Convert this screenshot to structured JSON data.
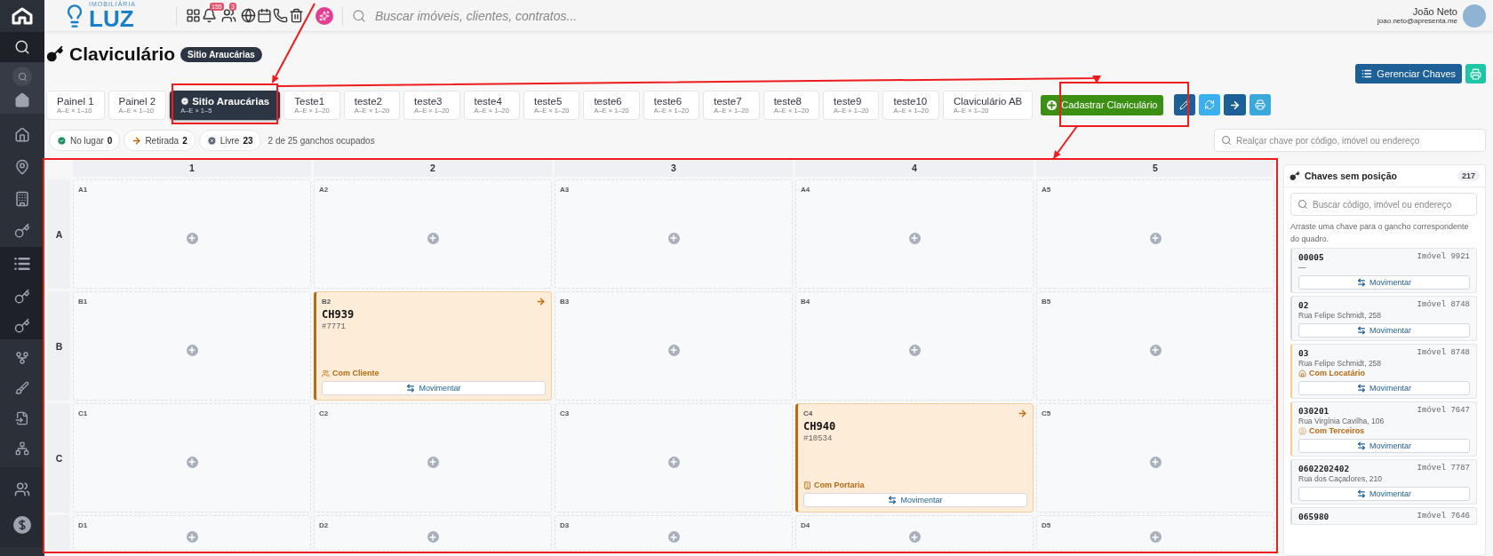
{
  "topbar": {
    "logo_caption": "IMOBILIÁRIA",
    "logo": "LUZ",
    "notification_count": "155",
    "user_count": "3",
    "search_placeholder": "Buscar imóveis, clientes, contratos...",
    "user": {
      "name": "João Neto",
      "email": "joao.neto@apresenta.me"
    }
  },
  "header": {
    "title": "Claviculário",
    "badge": "Sitio Araucárias",
    "manage_button": "Gerenciar Chaves"
  },
  "tabs": [
    {
      "label": "Painel 1",
      "sub": "A–E × 1–10",
      "selected": false
    },
    {
      "label": "Painel 2",
      "sub": "A–E × 1–10",
      "selected": false
    },
    {
      "label": "Sitio Araucárias",
      "sub": "A–E × 1–5",
      "selected": true
    },
    {
      "label": "Teste1",
      "sub": "A–E × 1–20",
      "selected": false
    },
    {
      "label": "teste2",
      "sub": "A–E × 1–20",
      "selected": false
    },
    {
      "label": "teste3",
      "sub": "A–E × 1–20",
      "selected": false
    },
    {
      "label": "teste4",
      "sub": "A–E × 1–20",
      "selected": false
    },
    {
      "label": "teste5",
      "sub": "A–E × 1–20",
      "selected": false
    },
    {
      "label": "teste6",
      "sub": "A–E × 1–20",
      "selected": false
    },
    {
      "label": "teste6",
      "sub": "A–E × 1–20",
      "selected": false
    },
    {
      "label": "teste7",
      "sub": "A–E × 1–20",
      "selected": false
    },
    {
      "label": "teste8",
      "sub": "A–E × 1–20",
      "selected": false
    },
    {
      "label": "teste9",
      "sub": "A–E × 1–20",
      "selected": false
    },
    {
      "label": "teste10",
      "sub": "A–E × 1–20",
      "selected": false
    },
    {
      "label": "Claviculário AB",
      "sub": "A–E × 1–20",
      "selected": false
    }
  ],
  "create_button": "Cadastrar Claviculário",
  "filters": [
    {
      "kind": "present",
      "label": "No lugar",
      "count": "0"
    },
    {
      "kind": "out",
      "label": "Retirada",
      "count": "2"
    },
    {
      "kind": "free",
      "label": "Livre",
      "count": "23"
    }
  ],
  "occupancy": "2 de 25 ganchos ocupados",
  "highlight_search": {
    "placeholder": "Realçar chave por código, imóvel ou endereço"
  },
  "board": {
    "columns": [
      "1",
      "2",
      "3",
      "4",
      "5"
    ],
    "rows": [
      {
        "label": "A",
        "cells": [
          {
            "kind": "empty",
            "code": "A1"
          },
          {
            "kind": "empty",
            "code": "A2"
          },
          {
            "kind": "empty",
            "code": "A3"
          },
          {
            "kind": "empty",
            "code": "A4"
          },
          {
            "kind": "empty",
            "code": "A5"
          }
        ]
      },
      {
        "label": "B",
        "cells": [
          {
            "kind": "empty",
            "code": "B1"
          },
          {
            "kind": "key",
            "code": "B2",
            "key": "CH939",
            "ref": "#7771",
            "status": {
              "kind": "client",
              "text": "Com Cliente"
            },
            "action": "Movimentar"
          },
          {
            "kind": "empty",
            "code": "B3"
          },
          {
            "kind": "empty",
            "code": "B4"
          },
          {
            "kind": "empty",
            "code": "B5"
          }
        ]
      },
      {
        "label": "C",
        "cells": [
          {
            "kind": "empty",
            "code": "C1"
          },
          {
            "kind": "empty",
            "code": "C2"
          },
          {
            "kind": "empty",
            "code": "C3"
          },
          {
            "kind": "key",
            "code": "C4",
            "key": "CH940",
            "ref": "#10534",
            "status": {
              "kind": "concierge",
              "text": "Com Portaria"
            },
            "action": "Movimentar"
          },
          {
            "kind": "empty",
            "code": "C5"
          }
        ]
      },
      {
        "cells": [
          {
            "kind": "empty",
            "code": "D1"
          },
          {
            "kind": "empty",
            "code": "D2"
          },
          {
            "kind": "empty",
            "code": "D3"
          },
          {
            "kind": "empty",
            "code": "D4"
          },
          {
            "kind": "empty",
            "code": "D5"
          }
        ]
      }
    ]
  },
  "unpositioned": {
    "title": "Chaves sem posição",
    "count": "217",
    "search_placeholder": "Buscar código, imóvel ou endereço",
    "hint": "Arraste uma chave para o gancho correspondente do quadro.",
    "items": [
      {
        "code": "00005",
        "property": "Imóvel 9921",
        "address": "—",
        "action": "Movimentar"
      },
      {
        "code": "02",
        "property": "Imóvel 8748",
        "address": "Rua Felipe Schmidt, 258",
        "action": "Movimentar"
      },
      {
        "code": "03",
        "property": "Imóvel 8748",
        "address": "Rua Felipe Schmidt, 258",
        "status": {
          "kind": "tenant",
          "text": "Com Locatário"
        },
        "action": "Movimentar"
      },
      {
        "code": "030201",
        "property": "Imóvel 7647",
        "address": "Rua Virgínia Cavilha, 106",
        "status": {
          "kind": "third_party",
          "text": "Com Terceiros"
        },
        "action": "Movimentar"
      },
      {
        "code": "0602202402",
        "property": "Imóvel 7787",
        "address": "Rua dos Caçadores, 210",
        "action": "Movimentar"
      },
      {
        "code": "065980",
        "property": "Imóvel 7646"
      }
    ]
  }
}
